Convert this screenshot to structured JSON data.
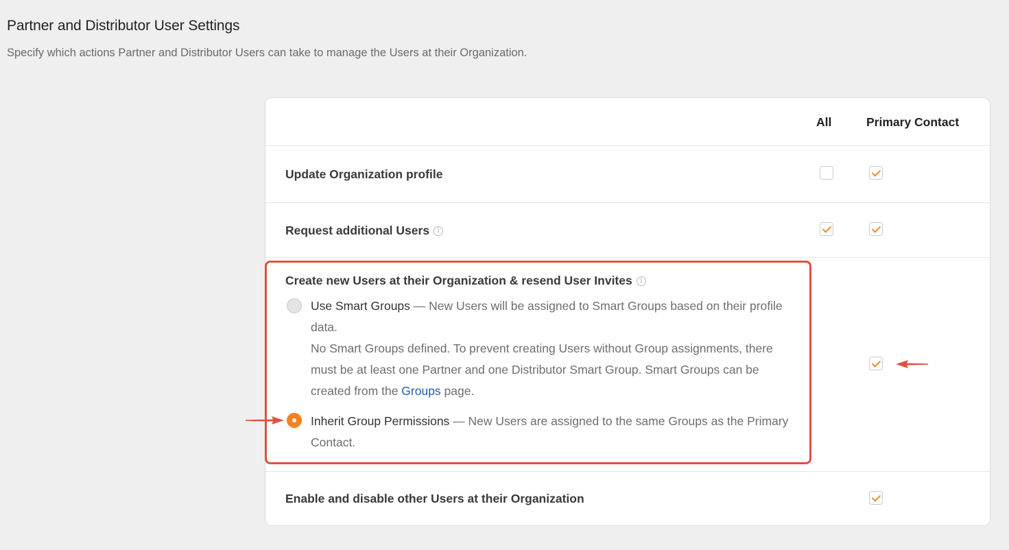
{
  "page": {
    "title": "Partner and Distributor User Settings",
    "description": "Specify which actions Partner and Distributor Users can take to manage the Users at their Organization."
  },
  "table": {
    "headers": {
      "all": "All",
      "primary_contact": "Primary Contact"
    },
    "rows": [
      {
        "label": "Update Organization profile",
        "all_checked": false,
        "primary_contact_checked": true
      },
      {
        "label": "Request additional Users",
        "info_icon": "info-icon",
        "all_checked": true,
        "primary_contact_checked": true
      },
      {
        "label": "Create new Users at their Organization & resend User Invites",
        "info_icon": "info-icon",
        "primary_contact_checked": true,
        "options": [
          {
            "name": "Use Smart Groups",
            "text": " — New Users will be assigned to Smart Groups based on their profile data.",
            "note_before_link": "No Smart Groups defined. To prevent creating Users without Group assignments, there must be at least one Partner and one Distributor Smart Group. Smart Groups can be created from the ",
            "link": "Groups",
            "note_after_link": " page.",
            "selected": false
          },
          {
            "name": "Inherit Group Permissions",
            "text": " — New Users are assigned to the same Groups as the Primary Contact.",
            "selected": true
          }
        ]
      },
      {
        "label": "Enable and disable other Users at their Organization",
        "primary_contact_checked": true
      }
    ]
  },
  "colors": {
    "accent": "#f58220",
    "annotation": "#e05040",
    "link": "#1f5ea8"
  }
}
